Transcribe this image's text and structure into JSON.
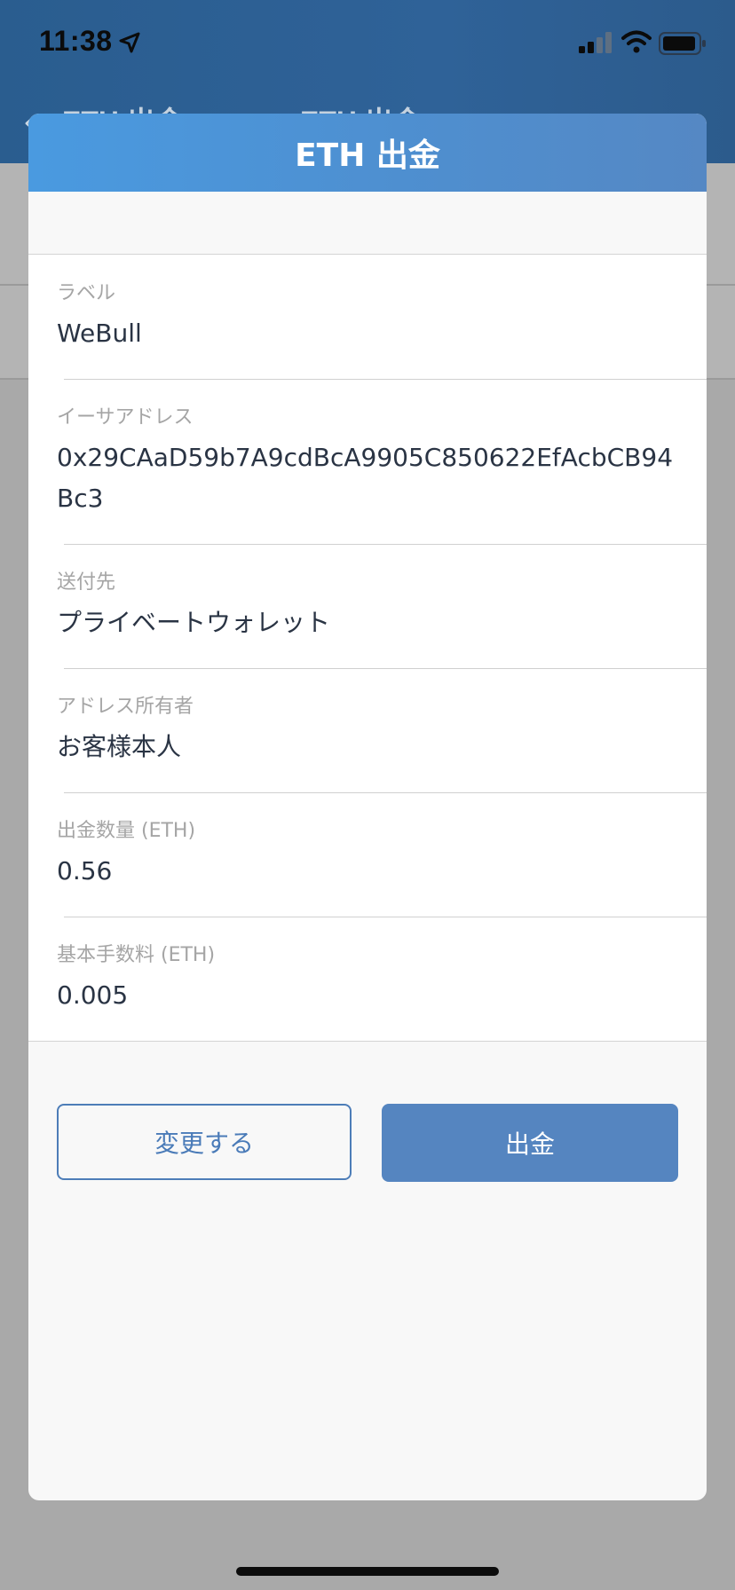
{
  "status_bar": {
    "time": "11:38",
    "icons": [
      "location-arrow-icon",
      "cellular-signal-icon",
      "wifi-icon",
      "battery-icon"
    ]
  },
  "background_nav": {
    "back_label": "ETH 出金",
    "title": "ETH 出金"
  },
  "modal": {
    "title": "ETH 出金",
    "fields": [
      {
        "label": "ラベル",
        "value": "WeBull"
      },
      {
        "label": "イーサアドレス",
        "value": "0x29CAaD59b7A9cdBcA9905C850622EfAcbCB94Bc3"
      },
      {
        "label": "送付先",
        "value": "プライベートウォレット"
      },
      {
        "label": "アドレス所有者",
        "value": "お客様本人"
      },
      {
        "label": "出金数量 (ETH)",
        "value": "0.56"
      },
      {
        "label": "基本手数料 (ETH)",
        "value": "0.005"
      }
    ],
    "buttons": {
      "change_label": "変更する",
      "withdraw_label": "出金"
    }
  },
  "colors": {
    "header_blue": "#4e8fd0",
    "button_blue": "#5585c0",
    "text_dark": "#2a3444",
    "label_gray": "#a5a5a5"
  }
}
